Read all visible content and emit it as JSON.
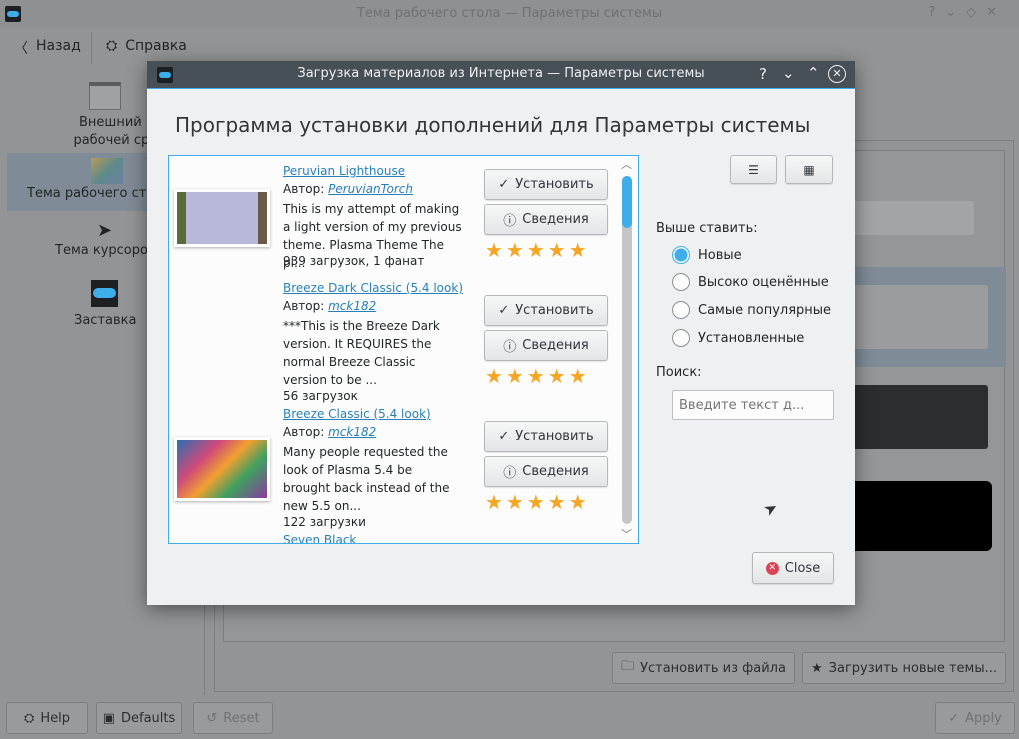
{
  "main_window": {
    "title": "Тема рабочего стола — Параметры системы",
    "toolbar": {
      "back": "Назад",
      "help": "Справка"
    },
    "sidebar": [
      {
        "label": "Внешний вид рабочей среды",
        "icon": "window-icon"
      },
      {
        "label": "Тема рабочего стола",
        "icon": "desktop-theme-icon",
        "selected": true
      },
      {
        "label": "Тема курсоров",
        "icon": "cursor-icon"
      },
      {
        "label": "Заставка",
        "icon": "splash-toggle-icon"
      }
    ],
    "install_from_file": "Установить из файла",
    "get_new_themes": "Загрузить новые темы...",
    "bottom": {
      "help": "Help",
      "defaults": "Defaults",
      "reset": "Reset",
      "apply": "Apply"
    }
  },
  "dialog": {
    "title": "Загрузка материалов из Интернета — Параметры системы",
    "heading": "Программа установки дополнений для Параметры системы",
    "author_label": "Автор:",
    "install_label": "Установить",
    "details_label": "Сведения",
    "items": [
      {
        "name": "Peruvian Lighthouse",
        "author": "PeruvianTorch",
        "description": "This is my attempt of making a light version of my previous theme. Plasma Theme The pl...",
        "stats": "939 загрузок, 1 фанат",
        "rating": 5
      },
      {
        "name": "Breeze Dark Classic (5.4 look)",
        "author": "mck182",
        "description": "***This is the Breeze Dark version. It REQUIRES the normal Breeze Classic version to be ...",
        "stats": "56 загрузок",
        "rating": 5
      },
      {
        "name": "Breeze Classic (5.4 look)",
        "author": "mck182",
        "description": "Many people requested the look of Plasma 5.4 be brought back instead of the new 5.5 on...",
        "stats": "122 загрузки",
        "rating": 5
      },
      {
        "name": "Seven Black"
      }
    ],
    "sort_label": "Выше ставить:",
    "sort_options": [
      {
        "label": "Новые",
        "selected": true
      },
      {
        "label": "Высоко оценённые",
        "selected": false
      },
      {
        "label": "Самые популярные",
        "selected": false
      },
      {
        "label": "Установленные",
        "selected": false
      }
    ],
    "search_label": "Поиск:",
    "search_placeholder": "Введите текст д...",
    "close": "Close"
  },
  "colors": {
    "accent": "#3daee9",
    "titlebar": "#475057",
    "star": "#f5a623",
    "close_icon": "#da4453"
  }
}
